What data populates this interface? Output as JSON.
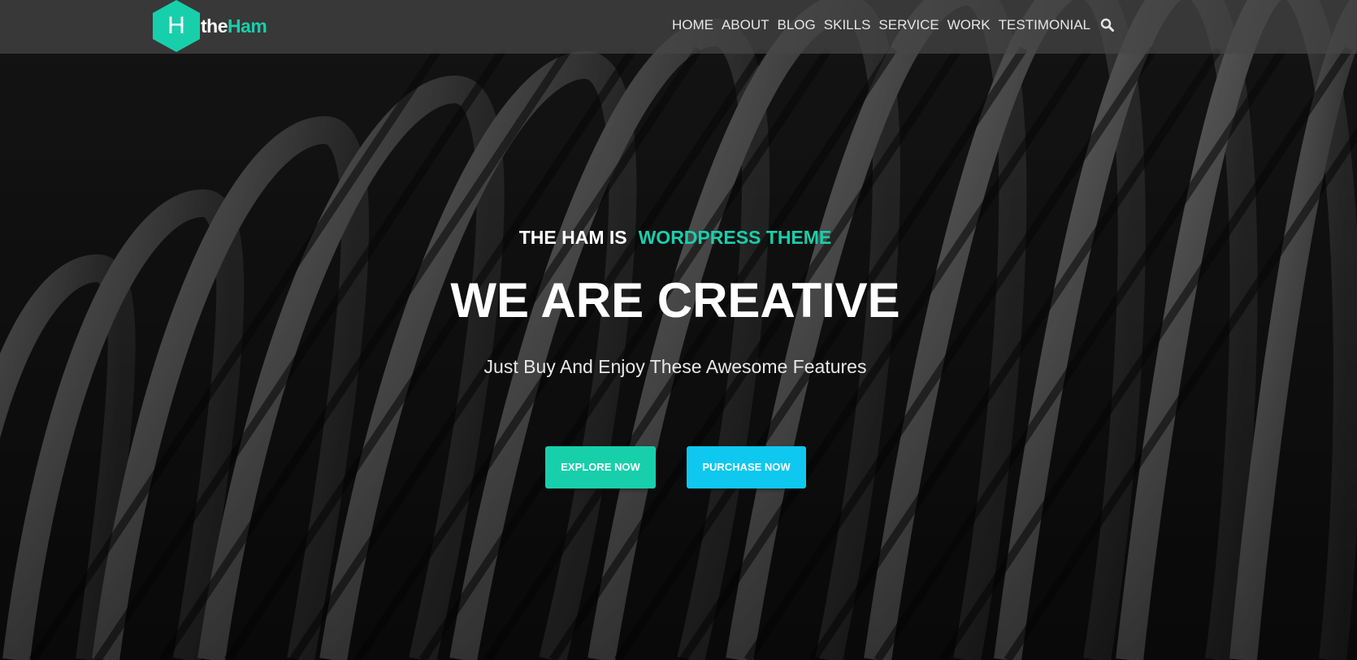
{
  "brand": {
    "logo_letter": "H",
    "name_prefix": "the",
    "name_suffix": "Ham",
    "accent_color": "#18cfab"
  },
  "nav": {
    "items": [
      {
        "label": "HOME"
      },
      {
        "label": "ABOUT"
      },
      {
        "label": "BLOG"
      },
      {
        "label": "SKILLS"
      },
      {
        "label": "SERVICE"
      },
      {
        "label": "WORK"
      },
      {
        "label": "TESTIMONIAL"
      }
    ],
    "search_icon": "search-icon"
  },
  "hero": {
    "tagline_lead": "THE HAM IS",
    "tagline_accent": "WORDPRESS THEME",
    "headline": "WE ARE CREATIVE",
    "subheadline": "Just Buy And Enjoy These Awesome Features",
    "primary_button": "EXPLORE NOW",
    "secondary_button": "PURCHASE NOW",
    "primary_color": "#18cfab",
    "secondary_color": "#0ec8f0"
  }
}
